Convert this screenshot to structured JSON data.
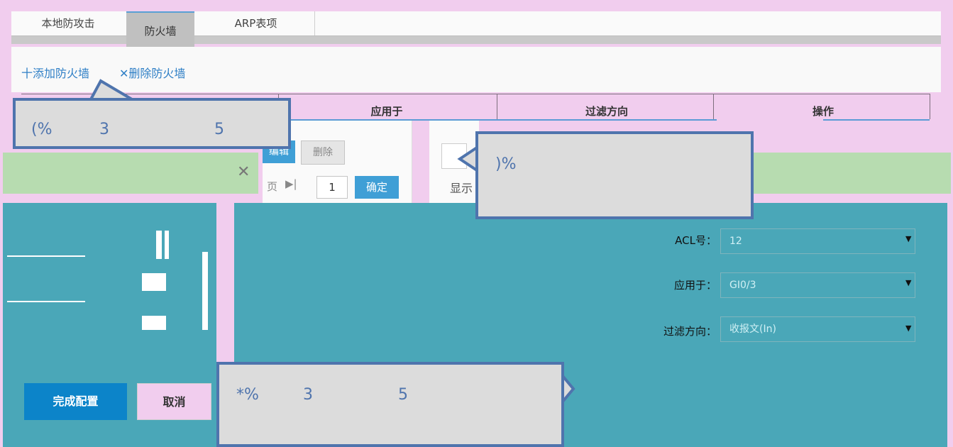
{
  "tabs": [
    {
      "label": "本地防攻击"
    },
    {
      "label": "防火墙"
    },
    {
      "label": "ARP表项"
    }
  ],
  "toolbar": {
    "add_label": "十添加防火墙",
    "delete_label": "✕删除防火墙"
  },
  "table": {
    "headers": [
      "应用于",
      "过滤方向",
      "操作"
    ]
  },
  "callouts": {
    "c1": {
      "a": "(%",
      "b": "3",
      "c": "5"
    },
    "c2": {
      "a": ")%"
    },
    "c3": {
      "a": "*%",
      "b": "3",
      "c": "5"
    }
  },
  "row_actions": {
    "edit_label": "编辑",
    "delete_label": "删除"
  },
  "pager": {
    "prev_label": "页",
    "page_value": "1",
    "confirm_label": "确定",
    "show_label": "显示"
  },
  "notice": {
    "close_glyph": "✕"
  },
  "form": {
    "acl_label": "ACL号：",
    "acl_value": "12",
    "apply_label": "应用于：",
    "apply_value": "GI0/3",
    "direction_label": "过滤方向：",
    "direction_value": "收报文(In)"
  },
  "buttons": {
    "done_label": "完成配置",
    "cancel_label": "取消"
  },
  "colors": {
    "accent": "#3f9fd6",
    "teal": "#4aa7b8",
    "notice": "#b7dcb0",
    "callout_border": "#4f74ad"
  }
}
